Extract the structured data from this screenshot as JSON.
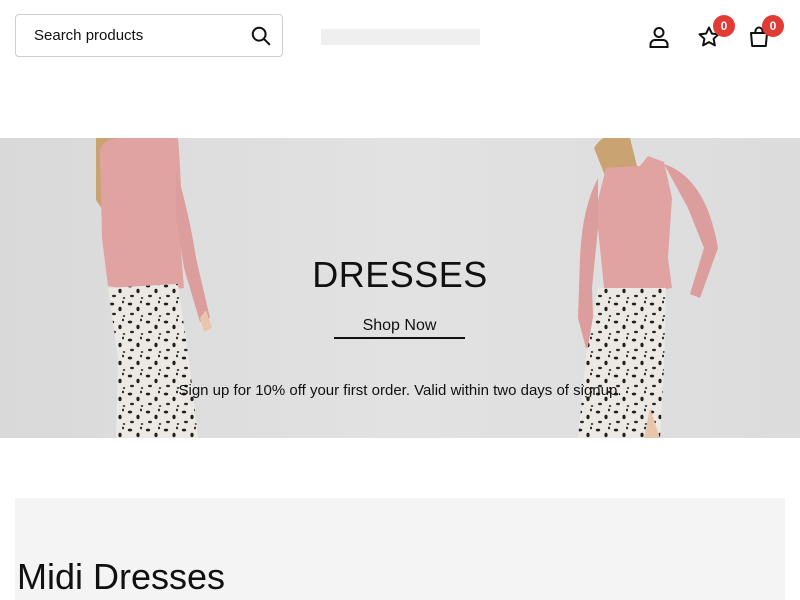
{
  "header": {
    "search": {
      "placeholder": "Search products",
      "value": "",
      "icon": "search-icon"
    },
    "icons": {
      "account": "user-icon",
      "wishlist": "star-icon",
      "cart": "bag-icon"
    },
    "wishlist_count": "0",
    "cart_count": "0",
    "badge_color": "#e23b36"
  },
  "hero": {
    "title": "DRESSES",
    "cta_label": "Shop Now",
    "note": "Sign up for 10% off your first order. Valid within two days of signup."
  },
  "section": {
    "title": "Midi Dresses"
  }
}
